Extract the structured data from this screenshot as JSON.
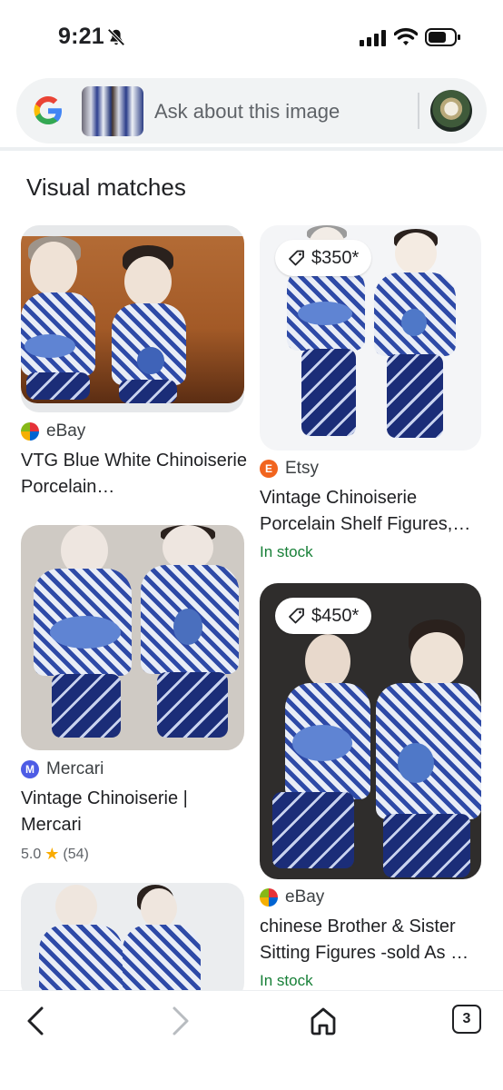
{
  "status_bar": {
    "time": "9:21",
    "icons": [
      "bell-off-icon",
      "signal-icon",
      "wifi-icon",
      "battery-icon"
    ]
  },
  "search": {
    "placeholder": "Ask about this image",
    "logo": "google-logo-icon"
  },
  "section": {
    "title": "Visual matches"
  },
  "results": [
    {
      "source": "eBay",
      "title": "VTG Blue White Chinoiserie Porcelain…",
      "price": "",
      "stock": "",
      "rating": ""
    },
    {
      "source": "Etsy",
      "title": "Vintage Chinoiserie Porcelain Shelf Figures,…",
      "price": "$350*",
      "stock": "In stock",
      "rating": ""
    },
    {
      "source": "Mercari",
      "title": "Vintage Chinoiserie | Mercari",
      "price": "",
      "stock": "",
      "rating": "5.0",
      "reviews": "(54)"
    },
    {
      "source": "eBay",
      "title": "chinese Brother & Sister Sitting Figures -sold As …",
      "price": "$450*",
      "stock": "In stock",
      "rating": ""
    },
    {
      "source": "",
      "title": "",
      "price": "",
      "stock": "",
      "rating": ""
    }
  ],
  "bottom_nav": {
    "tab_count": "3",
    "icons": [
      "back-icon",
      "forward-icon",
      "home-icon",
      "tabs-icon"
    ]
  },
  "colors": {
    "in_stock": "#188038",
    "star": "#f9ab00",
    "search_bg": "#f1f3f4"
  }
}
